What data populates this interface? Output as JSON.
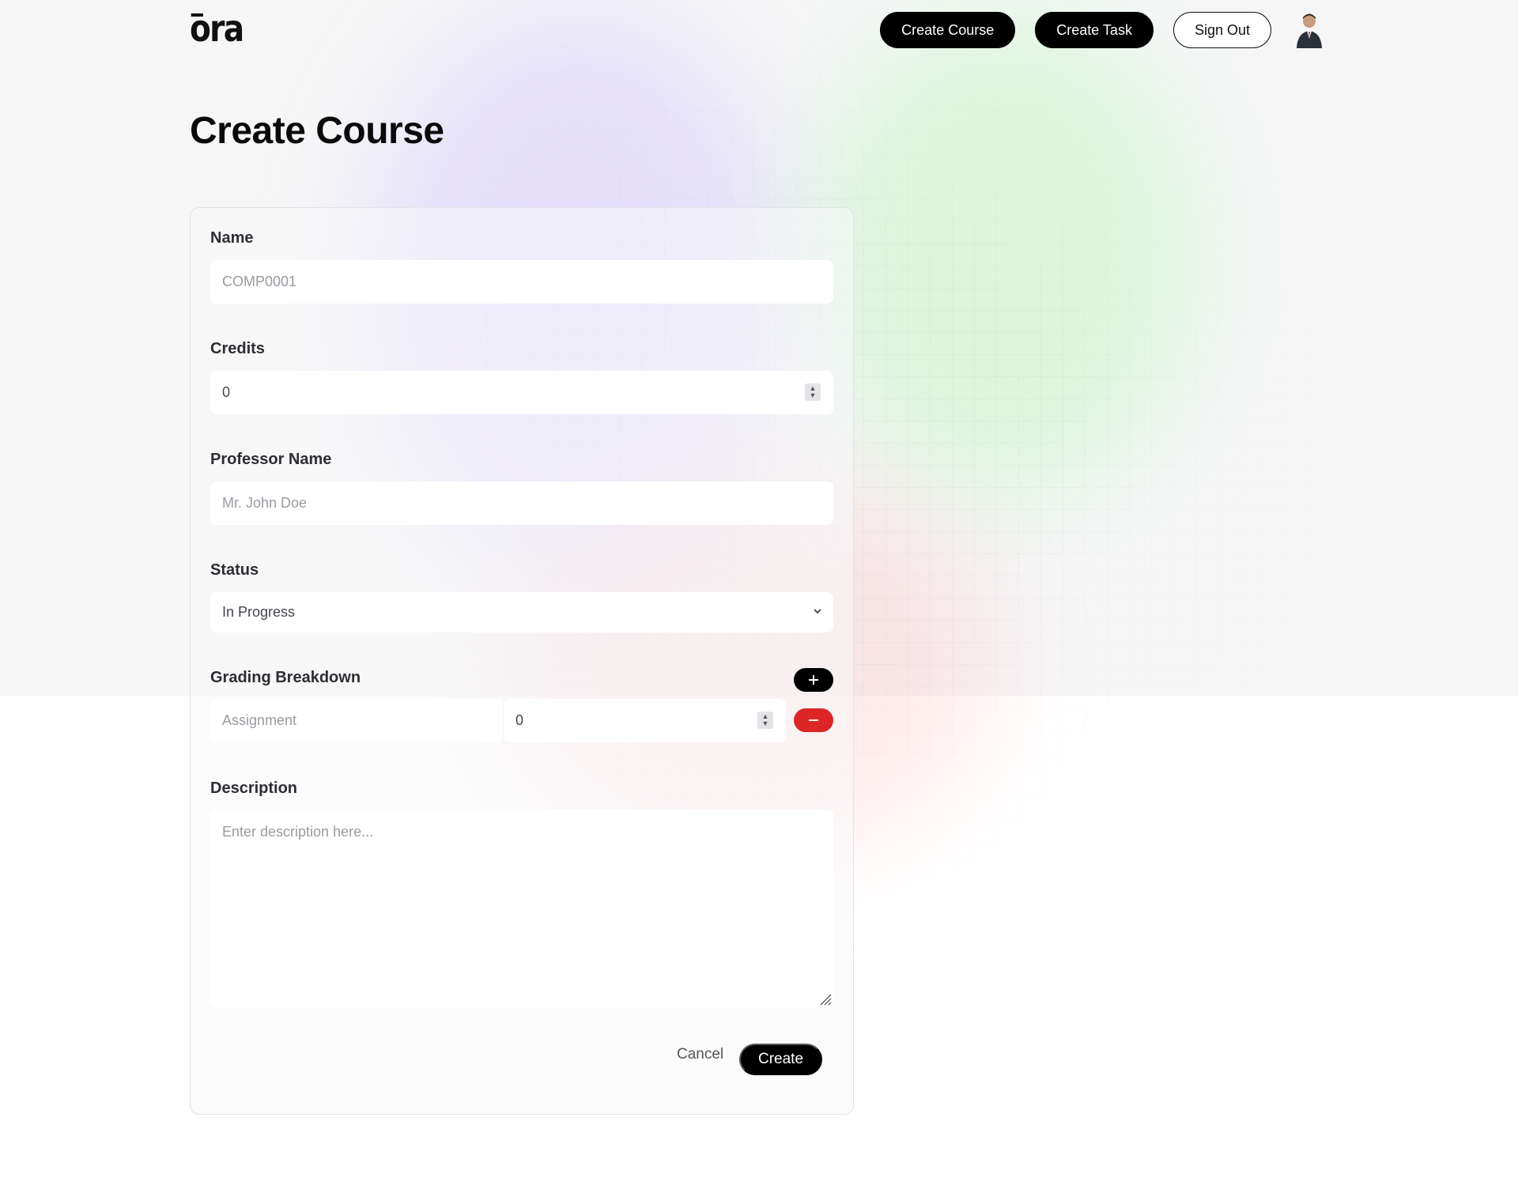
{
  "app": {
    "logo_text": "ora"
  },
  "header": {
    "create_course_label": "Create Course",
    "create_task_label": "Create Task",
    "sign_out_label": "Sign Out"
  },
  "page": {
    "title": "Create Course"
  },
  "form": {
    "name": {
      "label": "Name",
      "placeholder": "COMP0001"
    },
    "credits": {
      "label": "Credits",
      "value": "0"
    },
    "professor": {
      "label": "Professor Name",
      "placeholder": "Mr. John Doe"
    },
    "status": {
      "label": "Status",
      "selected": "In Progress"
    },
    "grading": {
      "label": "Grading Breakdown",
      "rows": [
        {
          "name_placeholder": "Assignment",
          "weight_value": "0"
        }
      ]
    },
    "description": {
      "label": "Description",
      "placeholder": "Enter description here..."
    },
    "cancel_label": "Cancel",
    "submit_label": "Create"
  },
  "icons": {
    "add": "plus-icon",
    "remove": "minus-icon",
    "dropdown": "chevron-down-icon",
    "spinner": "spinner-arrows-icon",
    "avatar": "user-avatar"
  },
  "colors": {
    "primary": "#000000",
    "danger": "#dc2626",
    "label": "#2d2d33",
    "placeholder": "#9a9aa2"
  }
}
